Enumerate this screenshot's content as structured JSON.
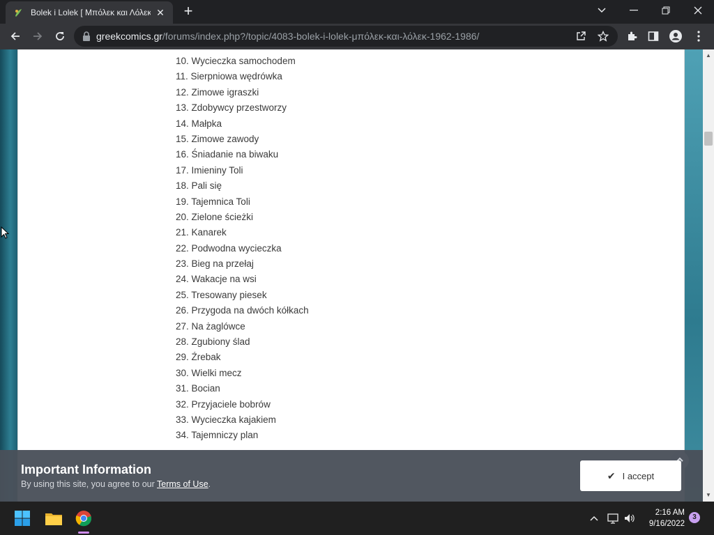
{
  "browser": {
    "tab_title": "Bolek i Lolek [ Μπόλεκ και Λόλεκ",
    "url_host": "greekcomics.gr",
    "url_path": "/forums/index.php?/topic/4083-bolek-i-lolek-μπόλεκ-και-λόλεκ-1962-1986/"
  },
  "list": {
    "items": [
      "10. Wycieczka samochodem",
      "11. Sierpniowa wędrówka",
      "12. Zimowe igraszki",
      "13. Zdobywcy przestworzy",
      "14. Małpka",
      "15. Zimowe zawody",
      "16. Śniadanie na biwaku",
      "17. Imieniny Toli",
      "18. Pali się",
      "19. Tajemnica Toli",
      "20. Zielone ścieżki",
      "21. Kanarek",
      "22. Podwodna wycieczka",
      "23. Bieg na przełaj",
      "24. Wakacje na wsi",
      "25. Tresowany piesek",
      "26. Przygoda na dwóch kółkach",
      "27. Na żaglówce",
      "28. Zgubiony ślad",
      "29. Źrebak",
      "30. Wielki mecz",
      "31. Bocian",
      "32. Przyjaciele bobrów",
      "33. Wycieczka kajakiem",
      "34. Tajemniczy plan"
    ]
  },
  "banner": {
    "title": "Important Information",
    "text": "By using this site, you agree to our ",
    "link": "Terms of Use",
    "suffix": ".",
    "accept_label": "I accept"
  },
  "taskbar": {
    "time": "2:16 AM",
    "date": "9/16/2022",
    "notification_count": "3"
  }
}
